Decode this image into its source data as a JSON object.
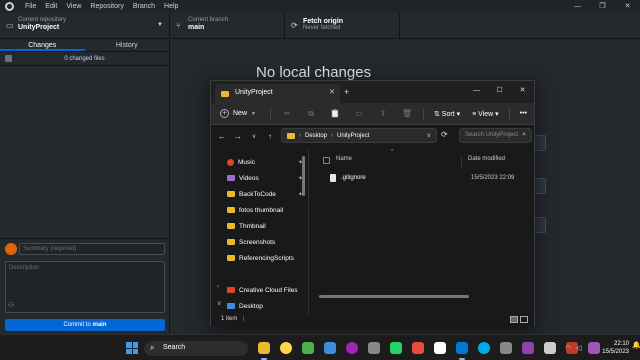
{
  "github": {
    "menu": [
      "File",
      "Edit",
      "View",
      "Repository",
      "Branch",
      "Help"
    ],
    "window_controls": [
      "—",
      "❐",
      "✕"
    ],
    "current_repository_label": "Current repository",
    "current_repository": "UnityProject",
    "current_branch_label": "Current branch",
    "current_branch": "main",
    "fetch_label": "Fetch origin",
    "fetch_status": "Never fetched",
    "tabs": [
      "Changes",
      "History"
    ],
    "changed_files": "0 changed files",
    "summary_placeholder": "Summary (required)",
    "description_placeholder": "Description",
    "commit_prefix": "Commit to ",
    "commit_branch": "main",
    "no_changes_title": "No local changes"
  },
  "explorer": {
    "tab_title": "UnityProject",
    "new_label": "New",
    "sort_label": "Sort",
    "view_label": "View",
    "more_label": "•••",
    "breadcrumb": [
      "Desktop",
      "UnityProject"
    ],
    "search_placeholder": "Search UnityProject",
    "nav_items": [
      {
        "label": "Music",
        "pinned": true
      },
      {
        "label": "Videos",
        "pinned": true
      },
      {
        "label": "BackToCode",
        "pinned": true
      },
      {
        "label": "fotos thumbnail",
        "pinned": false
      },
      {
        "label": "Thmbnail",
        "pinned": false
      },
      {
        "label": "Screenshots",
        "pinned": false
      },
      {
        "label": "ReferencingScripts",
        "pinned": false
      },
      {
        "label": "Creative Cloud Files",
        "pinned": false
      },
      {
        "label": "Desktop",
        "pinned": false
      }
    ],
    "columns": {
      "name": "Name",
      "date_modified": "Date modified"
    },
    "files": [
      {
        "name": ".gitignore",
        "date_modified": "15/5/2023 22:09"
      }
    ],
    "status": "1 item"
  },
  "taskbar": {
    "search_label": "Search",
    "time": "22:10",
    "date": "15/5/2023",
    "app_colors": [
      "#e8b931",
      "#ffd54a",
      "#4caf50",
      "#3c8de0",
      "#9c27b0",
      "#888888",
      "#25d366",
      "#e74c3c",
      "#ffffff",
      "#0078d4",
      "#00a8e8",
      "#888888",
      "#8e44ad",
      "#cccccc",
      "#c0392b",
      "#9b59b6"
    ]
  }
}
